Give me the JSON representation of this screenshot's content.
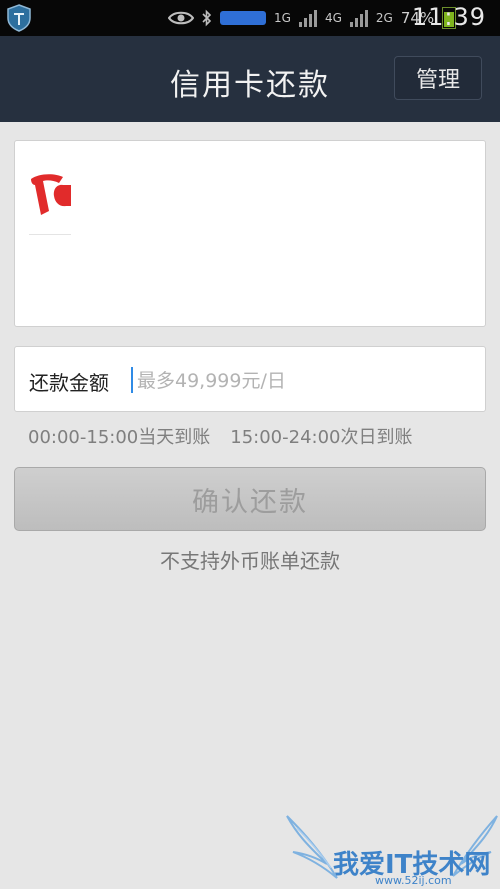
{
  "status_bar": {
    "battery_percent": "74%",
    "time": "11:39",
    "network_labels": [
      "1G",
      "4G",
      "2G"
    ],
    "battery_fill_fraction": 0.74,
    "icons": [
      "shield-app-icon",
      "eye-icon",
      "bluetooth-icon",
      "wifi-icon",
      "signal-icon",
      "battery-icon"
    ]
  },
  "nav": {
    "title": "信用卡还款",
    "manage_label": "管理"
  },
  "card": {
    "bank_logo_icon": "bank-logo-icon",
    "logo_color": "#e12b2b"
  },
  "amount": {
    "label": "还款金额",
    "placeholder": "最多49,999元/日",
    "value": ""
  },
  "hints": {
    "same_day": "00:00-15:00当天到账",
    "next_day": "15:00-24:00次日到账"
  },
  "confirm_label": "确认还款",
  "foreign_note": "不支持外币账单还款",
  "watermark": {
    "text": "我爱IT技术网",
    "url": "www.52ij.com"
  },
  "colors": {
    "nav_background": "#26303f",
    "page_background": "#e6e6e6",
    "caret": "#2f8be6"
  }
}
